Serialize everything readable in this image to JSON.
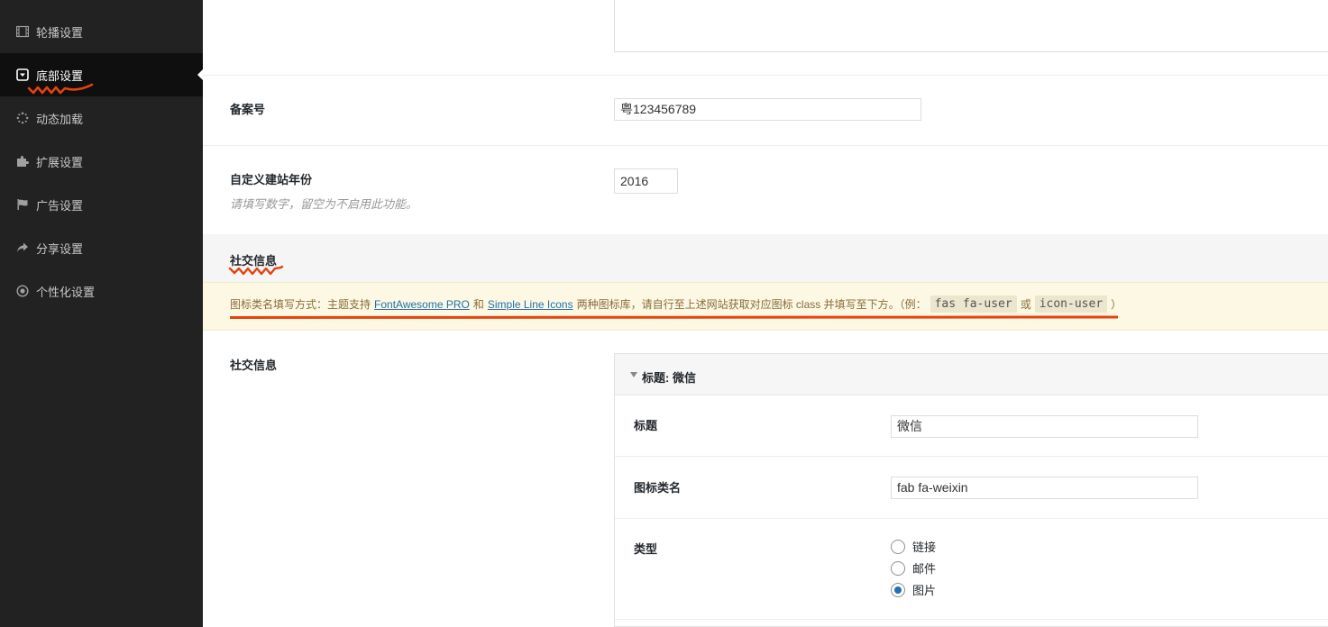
{
  "sidebar": {
    "items": [
      {
        "label": "轮播设置",
        "icon": "film-icon",
        "active": false
      },
      {
        "label": "底部设置",
        "icon": "caret-square-down-icon",
        "active": true
      },
      {
        "label": "动态加载",
        "icon": "spinner-icon",
        "active": false
      },
      {
        "label": "扩展设置",
        "icon": "puzzle-icon",
        "active": false
      },
      {
        "label": "广告设置",
        "icon": "flag-icon",
        "active": false
      },
      {
        "label": "分享设置",
        "icon": "share-icon",
        "active": false
      },
      {
        "label": "个性化设置",
        "icon": "bullseye-icon",
        "active": false
      }
    ]
  },
  "fields": {
    "icp": {
      "label": "备案号",
      "value": "粤123456789"
    },
    "year": {
      "label": "自定义建站年份",
      "description": "请填写数字，留空为不启用此功能。",
      "value": "2016"
    }
  },
  "social_section": {
    "title": "社交信息",
    "notice": {
      "prefix": "图标类名填写方式：主题支持",
      "link1": "FontAwesome PRO",
      "and": "和",
      "link2": "Simple Line Icons",
      "middle": "两种图标库，请自行至上述网站获取对应图标 class 并填写至下方。（例：",
      "code1": "fas fa-user",
      "or": "或",
      "code2": "icon-user",
      "suffix": "）"
    },
    "field_label": "社交信息",
    "group": {
      "header": "标题: 微信",
      "title_label": "标题",
      "title_value": "微信",
      "icon_label": "图标类名",
      "icon_value": "fab fa-weixin",
      "type_label": "类型",
      "type_options": [
        "链接",
        "邮件",
        "图片"
      ],
      "type_selected": "图片"
    }
  },
  "colors": {
    "sidebar_bg": "#222222",
    "sidebar_active_bg": "#0f0f0f",
    "notice_bg": "#fcf8e3",
    "link": "#2271b1",
    "annotation": "#e8410b"
  }
}
